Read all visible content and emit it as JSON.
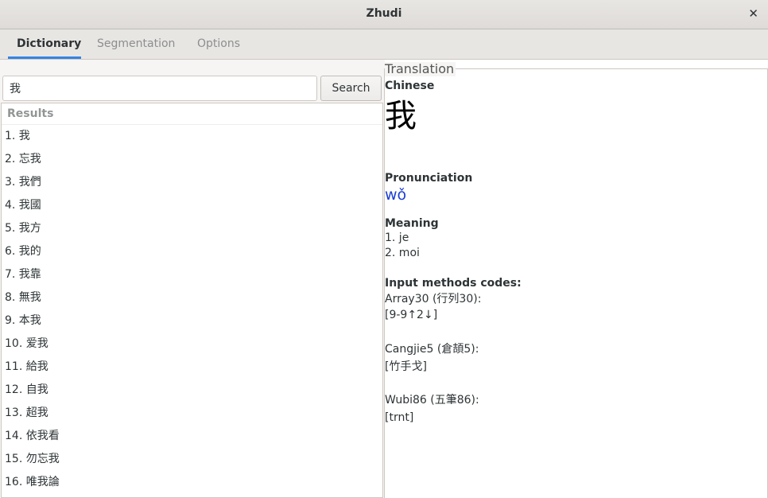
{
  "window": {
    "title": "Zhudi"
  },
  "tabs": [
    {
      "label": "Dictionary"
    },
    {
      "label": "Segmentation"
    },
    {
      "label": "Options"
    }
  ],
  "search": {
    "value": "我",
    "button_label": "Search"
  },
  "results": {
    "header": "Results",
    "items": [
      "1. 我",
      "2. 忘我",
      "3. 我們",
      "4. 我國",
      "5. 我方",
      "6. 我的",
      "7. 我靠",
      "8. 無我",
      "9. 本我",
      "10. 爱我",
      "11. 給我",
      "12. 自我",
      "13. 超我",
      "14. 依我看",
      "15. 勿忘我",
      "16. 唯我論"
    ]
  },
  "translation": {
    "legend": "Translation",
    "chinese_label": "Chinese",
    "chinese_value": "我",
    "pronunciation_label": "Pronunciation",
    "pronunciation_value": "wǒ",
    "meaning_label": "Meaning",
    "meanings": [
      "1. je",
      "2. moi"
    ],
    "input_methods_label": "Input methods codes:",
    "array30_label": "Array30 (行列30):",
    "array30_value": "[9-9↑2↓]",
    "cangjie5_label": "Cangjie5 (倉頡5):",
    "cangjie5_value": "[竹手戈]",
    "wubi86_label": "Wubi86 (五筆86):",
    "wubi86_value": "[trnt]"
  },
  "colors": {
    "accent": "#3584e4",
    "pinyin": "#1a3ed4"
  },
  "icons": {
    "close": "close-icon"
  }
}
